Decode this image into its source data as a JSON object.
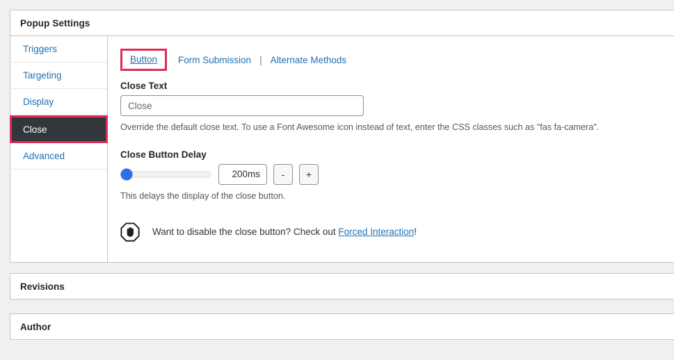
{
  "metabox": {
    "title": "Popup Settings"
  },
  "sidebar": {
    "items": [
      {
        "label": "Triggers",
        "active": false
      },
      {
        "label": "Targeting",
        "active": false
      },
      {
        "label": "Display",
        "active": false
      },
      {
        "label": "Close",
        "active": true
      },
      {
        "label": "Advanced",
        "active": false
      }
    ]
  },
  "tabs": {
    "items": [
      {
        "label": "Button",
        "current": true
      },
      {
        "label": "Form Submission",
        "current": false
      },
      {
        "label": "Alternate Methods",
        "current": false
      }
    ],
    "separator": "|"
  },
  "close_text": {
    "label": "Close Text",
    "input_value": "",
    "input_placeholder": "Close",
    "help": "Override the default close text. To use a Font Awesome icon instead of text, enter the CSS classes such as \"fas fa-camera\"."
  },
  "close_delay": {
    "label": "Close Button Delay",
    "value": "200ms",
    "slider_percent": 7,
    "decrement_label": "-",
    "increment_label": "+",
    "help": "This delays the display of the close button."
  },
  "notice": {
    "icon": "hand-stop-icon",
    "text_before": "Want to disable the close button? Check out ",
    "link_text": "Forced Interaction",
    "text_after": "!"
  },
  "panels": [
    {
      "title": "Revisions"
    },
    {
      "title": "Author"
    }
  ],
  "colors": {
    "accent_crimson": "#e02c54",
    "link_blue": "#2271b1",
    "slider_blue": "#2f6fed",
    "active_dark": "#32373c",
    "page_bg": "#f0f0f1",
    "border_gray": "#c3c4c7"
  }
}
